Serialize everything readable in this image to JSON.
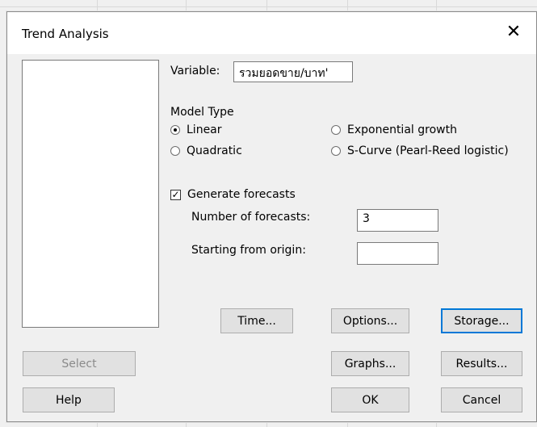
{
  "dialog": {
    "title": "Trend Analysis",
    "close_glyph": "✕"
  },
  "variable": {
    "label": "Variable:",
    "value": "รวมยอดขาย/บาท'"
  },
  "model_type": {
    "label": "Model Type",
    "options": [
      {
        "label": "Linear",
        "selected": true
      },
      {
        "label": "Exponential growth",
        "selected": false
      },
      {
        "label": "Quadratic",
        "selected": false
      },
      {
        "label": "S-Curve (Pearl-Reed logistic)",
        "selected": false
      }
    ]
  },
  "forecasts": {
    "checkbox_label": "Generate forecasts",
    "checked": true,
    "check_glyph": "✓",
    "number_label": "Number of forecasts:",
    "number_value": "3",
    "origin_label": "Starting from origin:",
    "origin_value": ""
  },
  "buttons": {
    "time": "Time...",
    "options": "Options...",
    "storage": "Storage...",
    "select": "Select",
    "graphs": "Graphs...",
    "results": "Results...",
    "help": "Help",
    "ok": "OK",
    "cancel": "Cancel"
  },
  "colors": {
    "focus_border": "#0078d7",
    "window_bg": "#f0f0f0"
  }
}
